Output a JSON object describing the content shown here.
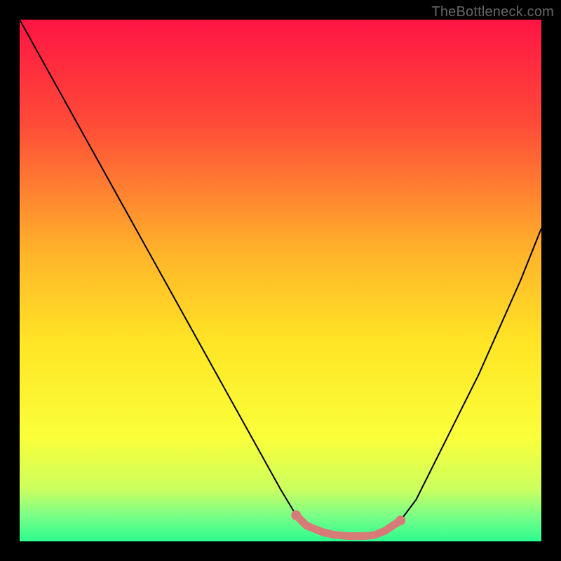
{
  "watermark": "TheBottleneck.com",
  "chart_data": {
    "type": "line",
    "title": "",
    "xlabel": "",
    "ylabel": "",
    "xlim": [
      0,
      100
    ],
    "ylim": [
      0,
      100
    ],
    "background_gradient": {
      "stops": [
        {
          "offset": 0.0,
          "color": "#ff1444"
        },
        {
          "offset": 0.2,
          "color": "#ff4b38"
        },
        {
          "offset": 0.45,
          "color": "#ffb52a"
        },
        {
          "offset": 0.62,
          "color": "#ffe525"
        },
        {
          "offset": 0.8,
          "color": "#faff3a"
        },
        {
          "offset": 0.9,
          "color": "#ccff5e"
        },
        {
          "offset": 0.95,
          "color": "#7bff87"
        },
        {
          "offset": 1.0,
          "color": "#2dfc8f"
        }
      ]
    },
    "series": [
      {
        "name": "bottleneck-curve",
        "color": "#000000",
        "x": [
          0,
          5,
          10,
          15,
          20,
          25,
          30,
          35,
          40,
          45,
          50,
          53,
          55,
          58,
          60,
          63,
          66,
          68,
          70,
          73,
          76,
          80,
          84,
          88,
          92,
          96,
          100
        ],
        "values": [
          100,
          91,
          82,
          73,
          64,
          55,
          46,
          37,
          28,
          19,
          10,
          5,
          3,
          1.8,
          1.3,
          1.0,
          1.0,
          1.2,
          2,
          4,
          8,
          16,
          24,
          32,
          41,
          50,
          60
        ]
      }
    ],
    "highlight_zone": {
      "name": "optimal-range",
      "color": "#d87a78",
      "x": [
        53,
        55,
        58,
        60,
        63,
        66,
        68,
        70,
        73
      ],
      "values": [
        5,
        3,
        1.8,
        1.3,
        1.0,
        1.0,
        1.2,
        2,
        4
      ]
    }
  }
}
